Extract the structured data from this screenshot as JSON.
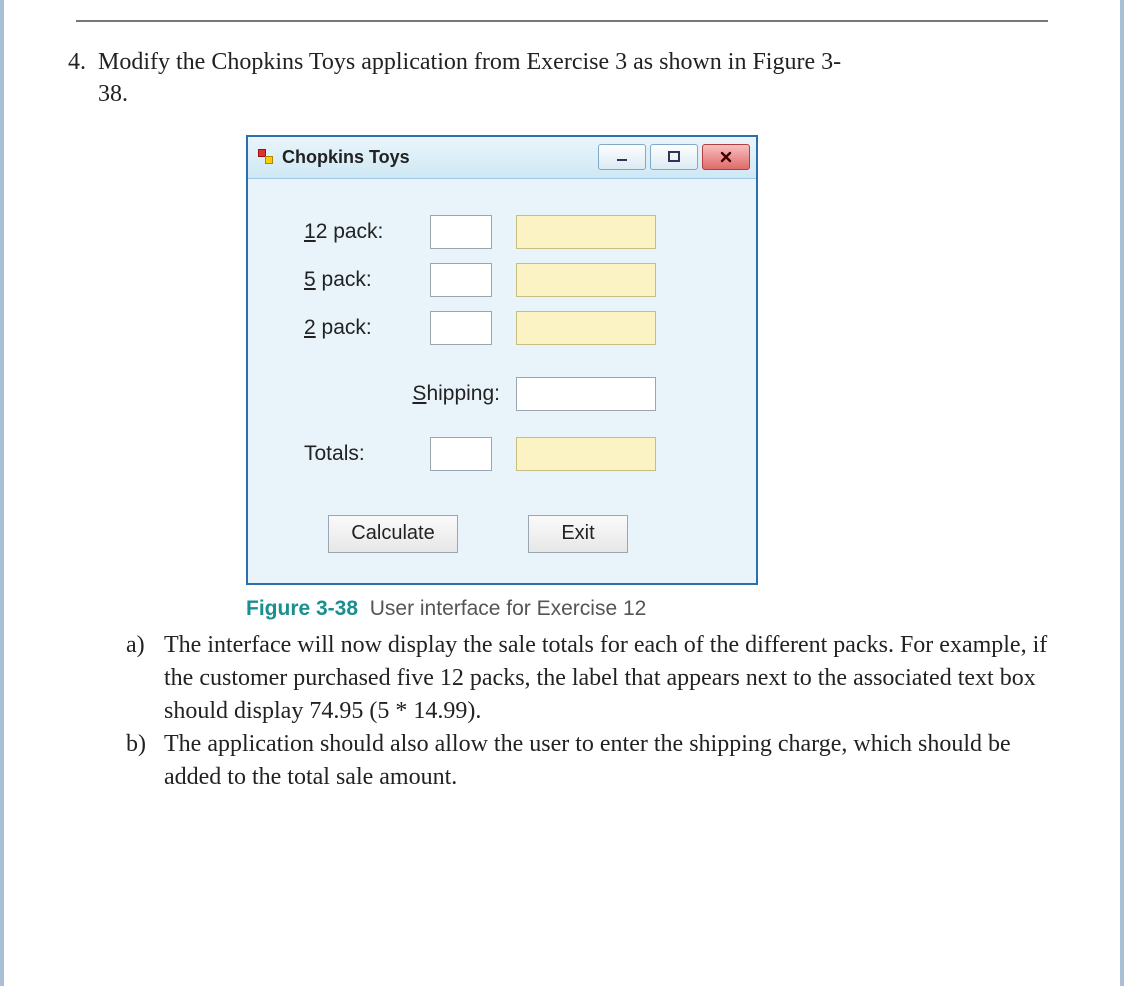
{
  "question": {
    "number": "4.",
    "text_line1": "Modify the Chopkins Toys application from Exercise 3 as shown in Figure 3-",
    "text_line2": "38."
  },
  "window": {
    "title": "Chopkins Toys",
    "labels": {
      "pack12_prefix": "1",
      "pack12_rest": "2 pack:",
      "pack5_prefix": "5",
      "pack5_rest": " pack:",
      "pack2_prefix": "2",
      "pack2_rest": " pack:",
      "shipping_prefix": "S",
      "shipping_rest": "hipping:",
      "totals": "Totals:"
    },
    "buttons": {
      "calculate_prefix": "C",
      "calculate_rest": "alculate",
      "exit_pre": "E",
      "exit_u": "x",
      "exit_post": "it"
    }
  },
  "caption": {
    "fig": "Figure 3-38",
    "text": "User interface for Exercise 12"
  },
  "sub": {
    "a_letter": "a)",
    "a_text": "The interface will now display the sale totals for each of the different packs. For example, if the customer purchased five 12 packs, the label that appears next to the associated text box should display 74.95 (5 * 14.99).",
    "b_letter": "b)",
    "b_text": "The application should also allow the user to enter the shipping charge, which should be added to the total sale amount."
  }
}
